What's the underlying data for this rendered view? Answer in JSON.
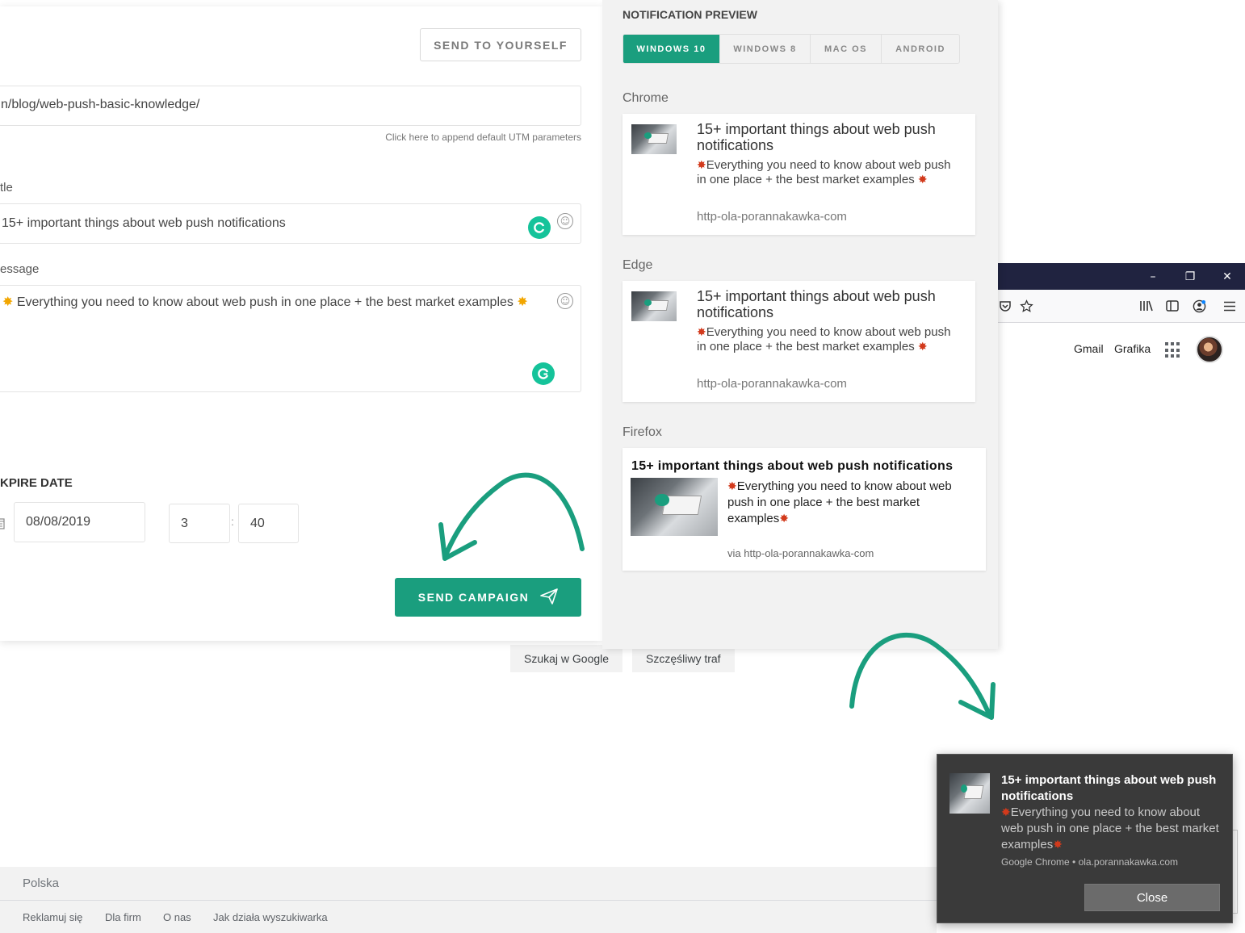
{
  "campaign_form": {
    "send_to_yourself_label": "SEND TO YOURSELF",
    "url_value": "n/blog/web-push-basic-knowledge/",
    "utm_helper": "Click here to append default UTM parameters",
    "title_label": "tle",
    "title_value": "15+ important things about web push notifications",
    "message_label": "essage",
    "message_value": "Everything you need to know about web push in one place + the best market examples",
    "expire_label": "KPIRE DATE",
    "expire_date": "08/08/2019",
    "expire_hour": "3",
    "time_separator": ":",
    "expire_minute": "40",
    "send_campaign_label": "SEND CAMPAIGN"
  },
  "preview": {
    "heading": "NOTIFICATION PREVIEW",
    "tabs": [
      {
        "label": "WINDOWS 10",
        "active": true
      },
      {
        "label": "WINDOWS 8",
        "active": false
      },
      {
        "label": "MAC OS",
        "active": false
      },
      {
        "label": "ANDROID",
        "active": false
      }
    ],
    "notification_title": "15+ important things about web push notifications",
    "notification_message": "Everything you need to know about web push in one place + the best market examples",
    "notification_url": "http-ola-porannakawka-com",
    "browsers": {
      "chrome": "Chrome",
      "edge": "Edge",
      "firefox": "Firefox"
    },
    "firefox_url": "via http-ola-porannakawka-com"
  },
  "google_page": {
    "gmail_link": "Gmail",
    "images_link": "Grafika",
    "search_button": "Szukaj w Google",
    "lucky_button": "Szczęśliwy traf",
    "country": "Polska",
    "footer_links": [
      "Reklamuj się",
      "Dla firm",
      "O nas",
      "Jak działa wyszukiwarka"
    ]
  },
  "window_controls": {
    "minimize_glyph": "–",
    "restore_glyph": "❐",
    "close_glyph": "✕"
  },
  "toast": {
    "title": "15+ important things about web push notifications",
    "message": "Everything you need to know about web push in one place + the best market examples",
    "source": "Google Chrome • ola.porannakawka.com",
    "close_label": "Close"
  },
  "colors": {
    "accent": "#1a9e7e",
    "titlebar": "#202340",
    "toast_bg": "#3a3a3a"
  },
  "icons": [
    "pocket-icon",
    "star-icon",
    "library-icon",
    "sidebar-icon",
    "account-icon",
    "hamburger-menu-icon",
    "apps-grid-icon",
    "avatar",
    "emoji-icon",
    "grammarly-icon",
    "calendar-icon",
    "send-paper-plane-icon",
    "burst-emoji-icon",
    "arrow-icon"
  ]
}
